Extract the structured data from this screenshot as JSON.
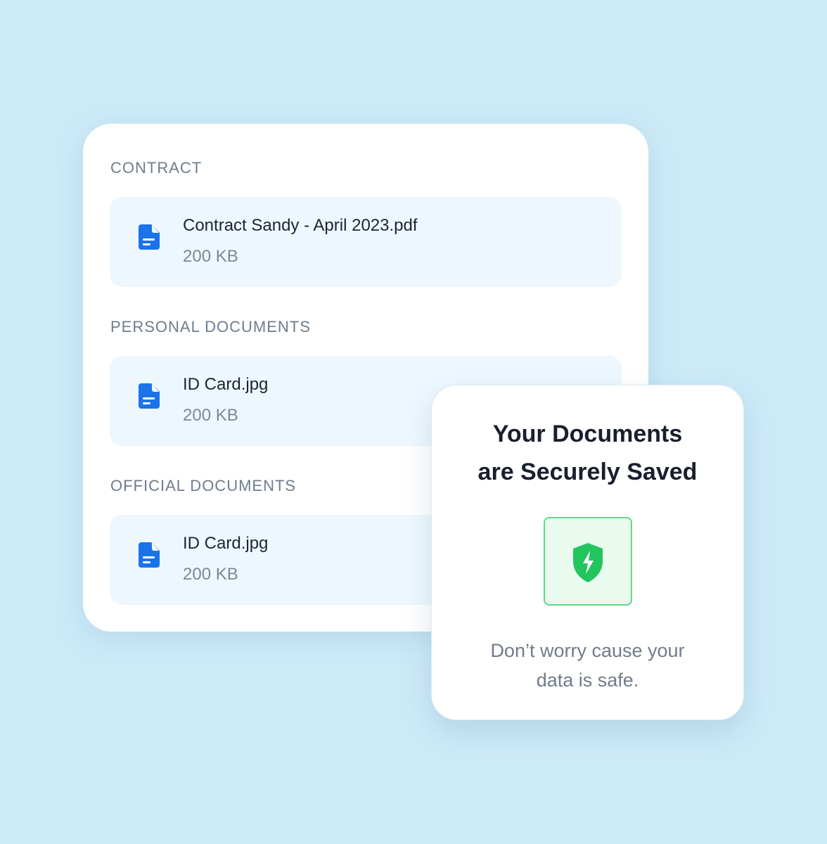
{
  "sections": [
    {
      "label": "CONTRACT",
      "file": {
        "name": "Contract Sandy - April 2023.pdf",
        "size": "200 KB",
        "icon": "file-icon"
      }
    },
    {
      "label": "PERSONAL DOCUMENTS",
      "file": {
        "name": "ID Card.jpg",
        "size": "200 KB",
        "icon": "file-icon"
      }
    },
    {
      "label": "OFFICIAL DOCUMENTS",
      "file": {
        "name": "ID Card.jpg",
        "size": "200 KB",
        "icon": "file-icon"
      }
    }
  ],
  "secure_card": {
    "title_line1": "Your Documents",
    "title_line2": "are Securely Saved",
    "icon": "shield-icon",
    "subtitle_line1": "Don’t worry cause your",
    "subtitle_line2": "data is safe."
  },
  "colors": {
    "background": "#cdeaf8",
    "accent_blue": "#1a73e8",
    "file_row_bg": "#eef7fe",
    "shield_green": "#22c55e",
    "shield_box_bg": "#e9fbef"
  }
}
